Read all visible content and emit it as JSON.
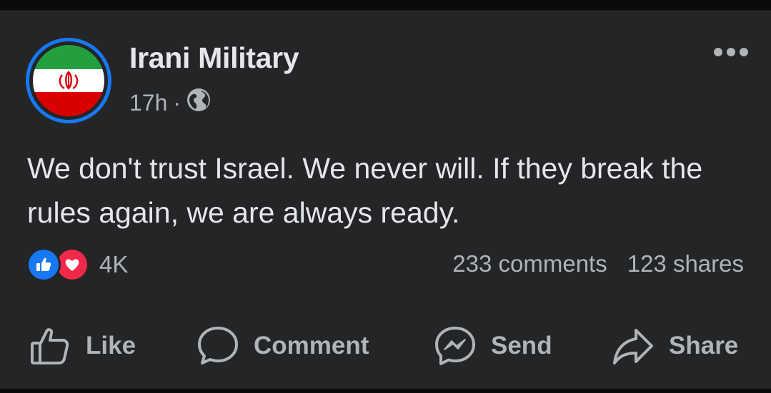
{
  "post": {
    "author": "Irani Military",
    "time": "17h",
    "separator": "·",
    "visibility_icon": "globe-icon",
    "text": "We don't trust Israel. We never will. If they break the rules again, we are always ready.",
    "reactions": {
      "icons": [
        "like-reaction-icon",
        "love-reaction-icon"
      ],
      "count": "4K"
    },
    "comments_count": "233 comments",
    "shares_count": "123 shares"
  },
  "actions": {
    "like": "Like",
    "comment": "Comment",
    "send": "Send",
    "share": "Share"
  },
  "colors": {
    "background": "#242526",
    "text_primary": "#e4e6eb",
    "text_secondary": "#b0b3b8",
    "accent": "#1877f2",
    "love": "#f0284a",
    "flag_green": "#239f40",
    "flag_white": "#ffffff",
    "flag_red": "#da0000"
  }
}
